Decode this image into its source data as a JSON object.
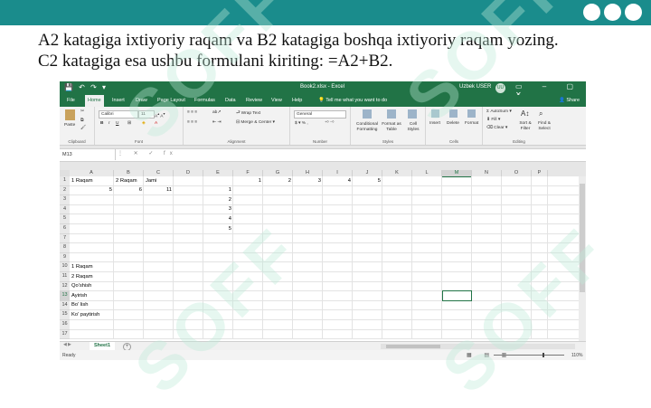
{
  "slide": {
    "instruction_line1": "A2 katagiga ixtiyoriy raqam va B2 katagiga boshqa ixtiyoriy raqam yozing.",
    "instruction_line2": "C2 katagiga esa ushbu formulani kiriting: =A2+B2.",
    "accent_color": "#1a8c8c"
  },
  "excel": {
    "doc_title": "Book2.xlsx - Excel",
    "user": "Uzbek USER",
    "avatar_initials": "UU",
    "tabs": [
      "File",
      "Home",
      "Insert",
      "Draw",
      "Page Layout",
      "Formulas",
      "Data",
      "Review",
      "View",
      "Help"
    ],
    "active_tab": "Home",
    "tell_me": "Tell me what you want to do",
    "share": "Share",
    "ribbon": {
      "groups": [
        "Clipboard",
        "Font",
        "Alignment",
        "Number",
        "Styles",
        "Cells",
        "Editing"
      ],
      "paste": "Paste",
      "font_name": "Calibri",
      "font_size": "11",
      "wrap_text": "Wrap Text",
      "merge_center": "Merge & Center",
      "number_format": "General",
      "conditional_formatting": "Conditional Formatting",
      "format_as_table": "Format as Table",
      "cell_styles": "Cell Styles",
      "insert": "Insert",
      "delete": "Delete",
      "format": "Format",
      "autosum": "AutoSum",
      "fill": "Fill",
      "clear": "Clear",
      "sort_filter": "Sort & Filter",
      "find_select": "Find & Select"
    },
    "name_box": "M13",
    "columns": [
      "A",
      "B",
      "C",
      "D",
      "E",
      "F",
      "G",
      "H",
      "I",
      "J",
      "K",
      "L",
      "M",
      "N",
      "O",
      "P"
    ],
    "selected_column": "M",
    "rows": [
      "1",
      "2",
      "3",
      "4",
      "5",
      "6",
      "7",
      "8",
      "9",
      "10",
      "11",
      "12",
      "13",
      "14",
      "15",
      "16",
      "17"
    ],
    "selected_row": "13",
    "cells": {
      "A1": "1 Raqam",
      "B1": "2 Raqam",
      "C1": "Jami",
      "A2": "5",
      "B2": "6",
      "C2": "11",
      "F1": "1",
      "G1": "2",
      "H1": "3",
      "I1": "4",
      "J1": "5",
      "E2": "1",
      "E3": "2",
      "E4": "3",
      "E5": "4",
      "E6": "5",
      "A10": "1 Raqam",
      "A11": "2 Raqam",
      "A12": "Qo'shish",
      "A13": "Ayirish",
      "A14": "Bo' lish",
      "A15": "Ko' paytirish"
    },
    "sheet_tab": "Sheet1",
    "status": "Ready",
    "zoom": "110%"
  },
  "watermark": "SOFF"
}
